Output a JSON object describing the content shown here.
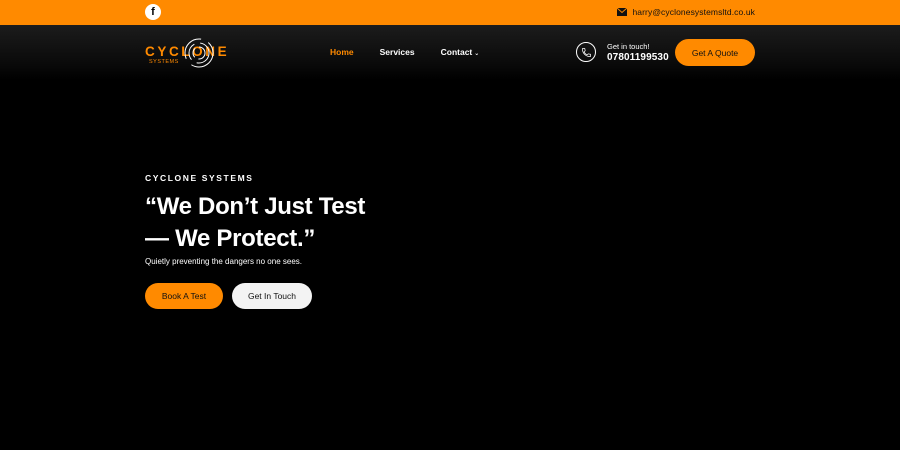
{
  "topbar": {
    "social_icon": "facebook-icon",
    "social_glyph": "f",
    "email": "harry@cyclonesystemsltd.co.uk"
  },
  "nav": {
    "logo_word": "CYCLONE",
    "logo_sub": "SYSTEMS",
    "items": [
      {
        "label": "Home",
        "active": true
      },
      {
        "label": "Services",
        "active": false
      },
      {
        "label": "Contact",
        "active": false
      }
    ],
    "contact_label": "Get in touch!",
    "contact_phone": "07801199530",
    "quote_button": "Get A Quote"
  },
  "hero": {
    "kicker": "CYCLONE SYSTEMS",
    "headline": "“We Don’t Just Test — We Protect.”",
    "tagline": "Quietly preventing the dangers no one sees.",
    "primary_button": "Book A Test",
    "secondary_button": "Get In Touch"
  },
  "colors": {
    "accent": "#ff8a00",
    "background": "#000000",
    "text": "#ffffff"
  }
}
